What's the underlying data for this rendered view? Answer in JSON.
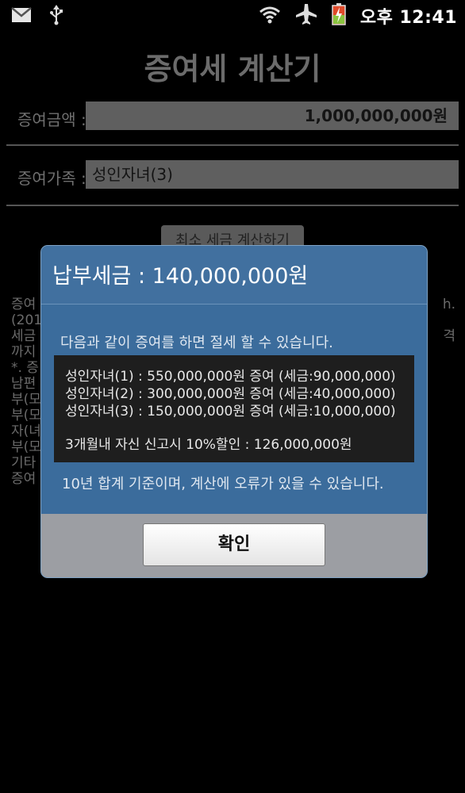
{
  "status_bar": {
    "icons": [
      "gmail-icon",
      "usb-icon",
      "wifi-icon",
      "airplane-mode-icon",
      "battery-charging-icon"
    ],
    "time": "오후 12:41"
  },
  "app": {
    "title": "증여세 계산기",
    "amount_label": "증여금액 :",
    "amount_value": "1,000,000,000원",
    "family_label": "증여가족 :",
    "family_value": "성인자녀(3)",
    "calc_button": "최소 세금 계산하기",
    "background_lines": [
      "증여",
      "(201",
      "세금",
      "까지",
      "*. 증",
      "남편",
      "부(모",
      "부(모",
      "자(녀",
      "부(모",
      "기타",
      "증여"
    ],
    "background_right": [
      "h.",
      "격"
    ]
  },
  "dialog": {
    "title": "납부세금 : 140,000,000원",
    "message": "다음과 같이 증여를 하면 절세 할 수 있습니다.",
    "lines": [
      "성인자녀(1) : 550,000,000원 증여 (세금:90,000,000)",
      "성인자녀(2) : 300,000,000원 증여 (세금:40,000,000)",
      "성인자녀(3) : 150,000,000원 증여 (세금:10,000,000)"
    ],
    "discount": "3개월내 자신 신고시 10%할인 : 126,000,000원",
    "footer": "10년 합계 기준이며, 계산에 오류가 있을 수 있습니다.",
    "ok_button": "확인"
  }
}
